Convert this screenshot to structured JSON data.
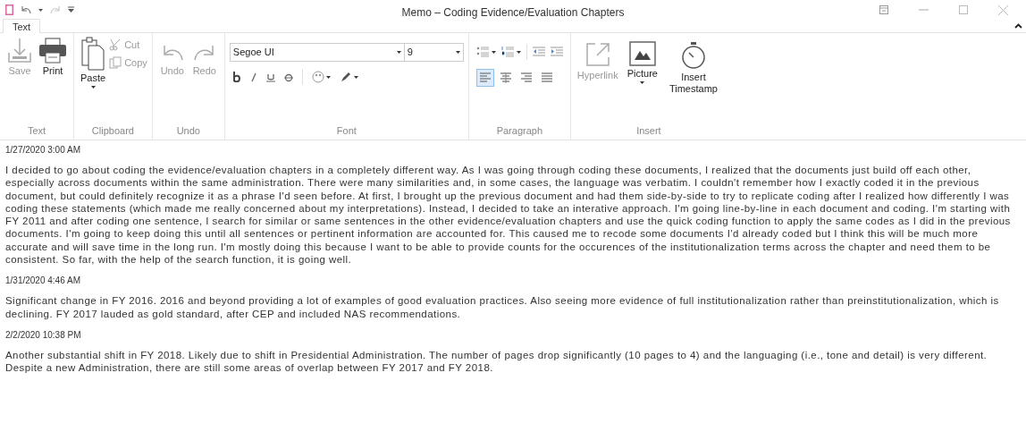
{
  "title_bar": {
    "title": "Memo – Coding Evidence/Evaluation Chapters"
  },
  "quick_access": [
    {
      "kind": "undo",
      "disabled": false
    },
    {
      "kind": "redo",
      "disabled": true
    }
  ],
  "tabs": [
    {
      "label": "Text",
      "selected": true
    }
  ],
  "ribbon": {
    "text_group": {
      "label": "Text",
      "buttons": [
        {
          "kind": "save",
          "label": "Save",
          "disabled": true
        },
        {
          "kind": "print",
          "label": "Print",
          "disabled": false
        }
      ]
    },
    "clipboard_group": {
      "label": "Clipboard",
      "paste": {
        "label": "Paste",
        "disabled": false
      },
      "small_buttons": [
        {
          "kind": "cut",
          "label": "Cut",
          "disabled": true
        },
        {
          "kind": "copy",
          "label": "Copy",
          "disabled": true
        }
      ]
    },
    "undo_group": {
      "label": "Undo",
      "buttons": [
        {
          "kind": "undo",
          "label": "Undo",
          "disabled": true
        },
        {
          "kind": "redo",
          "label": "Redo",
          "disabled": true
        }
      ]
    },
    "font_group": {
      "label": "Font",
      "font_name": "Segoe UI",
      "font_size": "9",
      "format_buttons": [
        {
          "kind": "bold"
        },
        {
          "kind": "italic"
        },
        {
          "kind": "underline"
        },
        {
          "kind": "strike"
        }
      ],
      "color_buttons": [
        {
          "kind": "font-color"
        },
        {
          "kind": "highlight"
        }
      ]
    },
    "paragraph_group": {
      "label": "Paragraph",
      "list_buttons": [
        {
          "kind": "bullets"
        },
        {
          "kind": "numbering"
        }
      ],
      "indent_buttons": [
        {
          "kind": "outdent"
        },
        {
          "kind": "indent"
        }
      ],
      "align_buttons": [
        {
          "kind": "left",
          "selected": true
        },
        {
          "kind": "center",
          "selected": false
        },
        {
          "kind": "right",
          "selected": false
        },
        {
          "kind": "justify",
          "selected": false
        }
      ]
    },
    "insert_group": {
      "label": "Insert",
      "buttons": [
        {
          "kind": "hyperlink",
          "label": "Hyperlink",
          "disabled": true,
          "dropdown": false
        },
        {
          "kind": "picture",
          "label": "Picture",
          "disabled": false,
          "dropdown": true
        },
        {
          "kind": "timestamp",
          "label": "Insert Timestamp",
          "disabled": false,
          "dropdown": false
        }
      ]
    }
  },
  "entries": [
    {
      "timestamp": "1/27/2020 3:00 AM",
      "text": "I decided to go about coding the evidence/evaluation chapters in a completely different way. As I was going through coding these documents, I realized that the documents just build off each other, especially across documents within the same administration. There were many similarities and, in some cases, the language was verbatim. I couldn't remember how I exactly coded it in the previous document, but could definitely recognize it as a phrase I'd seen before. At first, I brought up the previous document and had them side-by-side to try to replicate coding after I realized how differently I was coding these statements (which made me really concerned about my interpretations). Instead, I decided to take an interative approach. I'm going line-by-line in each document and coding. I'm starting with FY 2011 and after coding one sentence, I search for similar or same sentences in the other evidence/evaluation chapters and use the quick coding function to apply the same codes as I did in the previous documents. I'm going to keep doing this until all sentences or pertinent information are accounted for. This caused me to recode some documents I'd already coded but I think this will be much more accurate and will save time in the long run. I'm mostly doing this because I want to be able to provide counts for the occurences of the institutionalization terms across the chapter and need them to be consistent. So far, with the help of the search function, it is going well."
    },
    {
      "timestamp": "1/31/2020 4:46 AM",
      "text": "Significant change in FY 2016. 2016 and beyond providing a lot of examples of good evaluation practices. Also seeing more evidence of full institutionalization rather than preinstitutionalization, which is declining. FY 2017 lauded as gold standard, after CEP and included NAS recommendations."
    },
    {
      "timestamp": "2/2/2020 10:38 PM",
      "text": "Another substantial shift in FY 2018. Likely due to shift in Presidential Administration. The number of pages drop significantly (10 pages to 4) and the languaging (i.e., tone and detail) is very different. Despite a new Administration, there are still some areas of overlap between FY 2017 and FY 2018."
    }
  ]
}
